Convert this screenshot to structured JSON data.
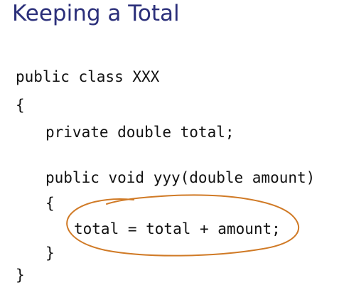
{
  "slide": {
    "title": "Keeping a Total",
    "code_lines": [
      "public class XXX",
      "{",
      "private double total;",
      "public void yyy(double amount)",
      "{",
      "total = total + amount;",
      "}",
      "}"
    ],
    "annotation_color": "#d07a26",
    "title_color": "#2b2f7a"
  }
}
